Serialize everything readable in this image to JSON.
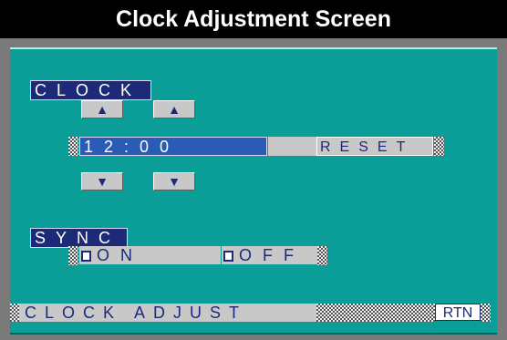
{
  "title": "Clock Adjustment Screen",
  "clock": {
    "label": "CLOCK",
    "up_hour": "▲",
    "up_minute": "▲",
    "time": "12:00",
    "reset": "RESET",
    "down_hour": "▼",
    "down_minute": "▼"
  },
  "sync": {
    "label": "SYNC",
    "on": "ON",
    "off": "OFF"
  },
  "status": {
    "text": "CLOCK ADJUST",
    "rtn": "RTN"
  },
  "colors": {
    "screen": "#0b9e98",
    "label_bg": "#1c2a78",
    "time_bar": "#2a5bb5",
    "button_bg": "#c8c8c8"
  }
}
